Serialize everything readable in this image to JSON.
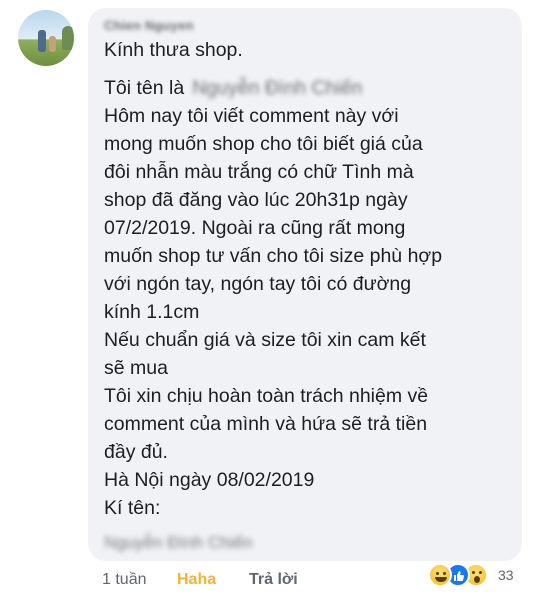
{
  "comment": {
    "author": "Chien Nguyen",
    "lines": [
      "Kính thưa shop.",
      "Tôi tên là",
      "Hôm nay tôi viết comment này với",
      "mong muốn shop cho tôi biết giá của",
      "đôi nhẫn màu trắng có chữ Tình mà",
      "shop đã đăng vào lúc 20h31p ngày",
      "07/2/2019. Ngoài ra cũng rất mong",
      "muốn shop tư vấn cho tôi size phù hợp",
      "với ngón tay, ngón tay tôi có đường",
      "kính 1.1cm",
      "Nếu chuẩn giá và size tôi xin cam kết",
      "sẽ mua",
      "Tôi xin chịu hoàn toàn trách nhiệm về",
      "comment của mình và hứa sẽ trả tiền",
      "đầy đủ.",
      "Hà Nội ngày 08/02/2019",
      "Kí tên:"
    ],
    "redacted_name": "Nguyễn Đình Chiến",
    "signature": "Nguyễn Đình Chiến"
  },
  "actions": {
    "time": "1 tuần",
    "reaction": "Haha",
    "reply": "Trả lời"
  },
  "reactions": {
    "icons": [
      "haha-icon",
      "like-icon",
      "wow-icon"
    ],
    "count": "33"
  },
  "colors": {
    "bubble_bg": "#f1f2f6",
    "text": "#1c1e21",
    "meta": "#606770",
    "haha": "#f0b33c",
    "like": "#1877f2"
  }
}
